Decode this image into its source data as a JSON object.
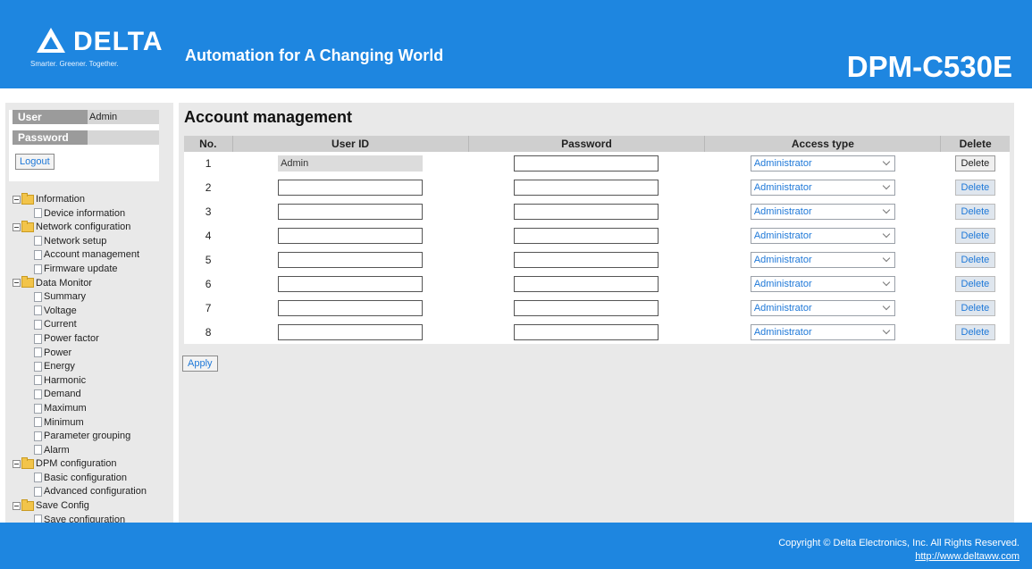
{
  "header": {
    "logo_text": "DELTA",
    "logo_tagline": "Smarter. Greener. Together.",
    "slogan": "Automation for A Changing World",
    "model": "DPM-C530E"
  },
  "login": {
    "user_label": "User",
    "user_value": "Admin",
    "password_label": "Password",
    "password_value": "",
    "logout_label": "Logout"
  },
  "nav": [
    {
      "type": "group",
      "label": "Information"
    },
    {
      "type": "leaf",
      "label": "Device information"
    },
    {
      "type": "group",
      "label": "Network configuration"
    },
    {
      "type": "leaf",
      "label": "Network setup"
    },
    {
      "type": "leaf",
      "label": "Account management"
    },
    {
      "type": "leaf",
      "label": "Firmware update"
    },
    {
      "type": "group",
      "label": "Data Monitor"
    },
    {
      "type": "leaf",
      "label": "Summary"
    },
    {
      "type": "leaf",
      "label": "Voltage"
    },
    {
      "type": "leaf",
      "label": "Current"
    },
    {
      "type": "leaf",
      "label": "Power factor"
    },
    {
      "type": "leaf",
      "label": "Power"
    },
    {
      "type": "leaf",
      "label": "Energy"
    },
    {
      "type": "leaf",
      "label": "Harmonic"
    },
    {
      "type": "leaf",
      "label": "Demand"
    },
    {
      "type": "leaf",
      "label": "Maximum"
    },
    {
      "type": "leaf",
      "label": "Minimum"
    },
    {
      "type": "leaf",
      "label": "Parameter grouping"
    },
    {
      "type": "leaf",
      "label": "Alarm"
    },
    {
      "type": "group",
      "label": "DPM configuration"
    },
    {
      "type": "leaf",
      "label": "Basic configuration"
    },
    {
      "type": "leaf",
      "label": "Advanced configuration"
    },
    {
      "type": "group",
      "label": "Save Config"
    },
    {
      "type": "leaf",
      "label": "Save configuration"
    }
  ],
  "main": {
    "title": "Account management",
    "columns": {
      "no": "No.",
      "user_id": "User ID",
      "password": "Password",
      "access_type": "Access type",
      "delete": "Delete"
    },
    "rows": [
      {
        "no": "1",
        "user_id": "Admin",
        "readonly": true,
        "password": "",
        "access": "Administrator",
        "delete": "Delete"
      },
      {
        "no": "2",
        "user_id": "",
        "readonly": false,
        "password": "",
        "access": "Administrator",
        "delete": "Delete"
      },
      {
        "no": "3",
        "user_id": "",
        "readonly": false,
        "password": "",
        "access": "Administrator",
        "delete": "Delete"
      },
      {
        "no": "4",
        "user_id": "",
        "readonly": false,
        "password": "",
        "access": "Administrator",
        "delete": "Delete"
      },
      {
        "no": "5",
        "user_id": "",
        "readonly": false,
        "password": "",
        "access": "Administrator",
        "delete": "Delete"
      },
      {
        "no": "6",
        "user_id": "",
        "readonly": false,
        "password": "",
        "access": "Administrator",
        "delete": "Delete"
      },
      {
        "no": "7",
        "user_id": "",
        "readonly": false,
        "password": "",
        "access": "Administrator",
        "delete": "Delete"
      },
      {
        "no": "8",
        "user_id": "",
        "readonly": false,
        "password": "",
        "access": "Administrator",
        "delete": "Delete"
      }
    ],
    "apply_label": "Apply"
  },
  "footer": {
    "copyright": "Copyright © Delta Electronics, Inc. All Rights Reserved.",
    "link": "http://www.deltaww.com"
  },
  "colors": {
    "brand_blue": "#1e86e0",
    "panel_gray": "#e9e9e9",
    "link_blue": "#1e78d8"
  }
}
